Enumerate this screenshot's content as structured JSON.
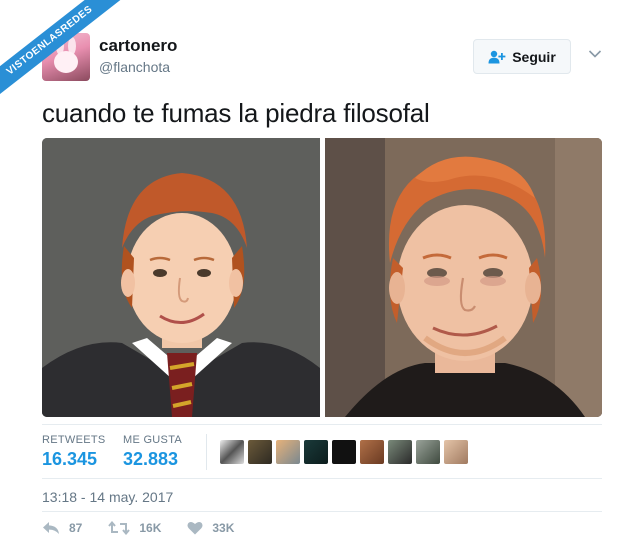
{
  "watermark": {
    "text": "VISTOENLASREDES"
  },
  "tweet": {
    "display_name": "cartonero",
    "handle": "@flanchota",
    "follow_label": "Seguir",
    "text": "cuando te fumas la piedra filosofal",
    "stats": {
      "retweets_label": "RETWEETS",
      "retweets_value": "16.345",
      "likes_label": "ME GUSTA",
      "likes_value": "32.883"
    },
    "timestamp": "13:18 - 14 may. 2017",
    "actions": {
      "reply_count": "87",
      "retweet_count": "16K",
      "like_count": "33K"
    }
  },
  "icons": {
    "follow": "add-user-icon",
    "menu": "chevron-down-icon",
    "reply": "reply-icon",
    "retweet": "retweet-icon",
    "like": "heart-icon"
  },
  "colors": {
    "accent": "#1b95e0",
    "muted": "#657786",
    "text": "#14171a",
    "watermark": "#2a8fd6"
  }
}
